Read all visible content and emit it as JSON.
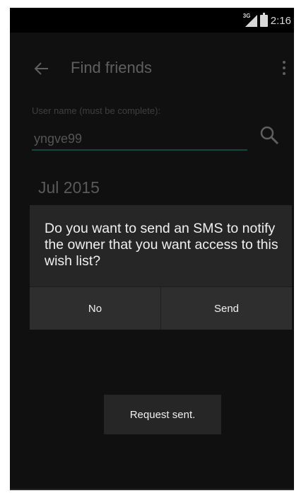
{
  "status_bar": {
    "network_label": "3G",
    "time": "2:16"
  },
  "app_bar": {
    "title": "Find friends",
    "icons": [
      "arrow-back-icon",
      "overflow-menu-icon"
    ]
  },
  "search": {
    "label": "User name (must be complete):",
    "value": "yngve99",
    "icon": "search-icon"
  },
  "list": {
    "date_heading": "Jul 2015"
  },
  "dialog": {
    "message": "Do you want to send an SMS to notify the owner that you want access to this wish list?",
    "buttons": {
      "negative": "No",
      "positive": "Send"
    }
  },
  "toast": {
    "message": "Request sent."
  },
  "colors": {
    "background": "#101010",
    "dialog": "#262626",
    "accent_underline": "#16463f",
    "text_primary": "#f0f0f0"
  }
}
